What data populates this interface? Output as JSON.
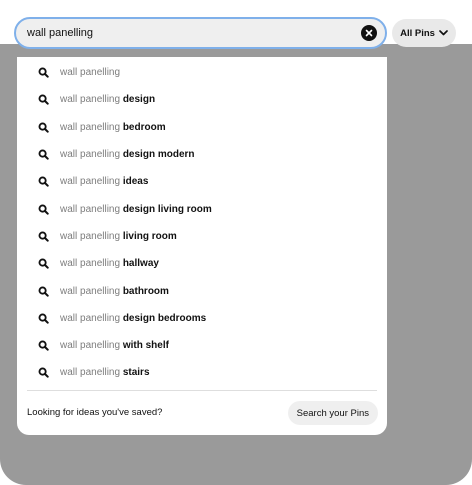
{
  "search": {
    "value": "wall panelling",
    "clear_icon": "close-icon"
  },
  "filter": {
    "label": "All Pins",
    "icon": "chevron-down-icon"
  },
  "suggestions": [
    {
      "prefix": "wall panelling",
      "suffix": ""
    },
    {
      "prefix": "wall panelling",
      "suffix": "design"
    },
    {
      "prefix": "wall panelling",
      "suffix": "bedroom"
    },
    {
      "prefix": "wall panelling",
      "suffix": "design modern"
    },
    {
      "prefix": "wall panelling",
      "suffix": "ideas"
    },
    {
      "prefix": "wall panelling",
      "suffix": "design living room"
    },
    {
      "prefix": "wall panelling",
      "suffix": "living room"
    },
    {
      "prefix": "wall panelling",
      "suffix": "hallway"
    },
    {
      "prefix": "wall panelling",
      "suffix": "bathroom"
    },
    {
      "prefix": "wall panelling",
      "suffix": "design bedrooms"
    },
    {
      "prefix": "wall panelling",
      "suffix": "with shelf"
    },
    {
      "prefix": "wall panelling",
      "suffix": "stairs"
    }
  ],
  "suggestion_icon": "search-icon",
  "footer": {
    "prompt": "Looking for ideas you've saved?",
    "button_label": "Search your Pins"
  },
  "colors": {
    "focus_ring": "#7fb0ea",
    "overlay": "#9a9a9a",
    "text_primary": "#111111",
    "text_muted": "#7d7d7d"
  }
}
